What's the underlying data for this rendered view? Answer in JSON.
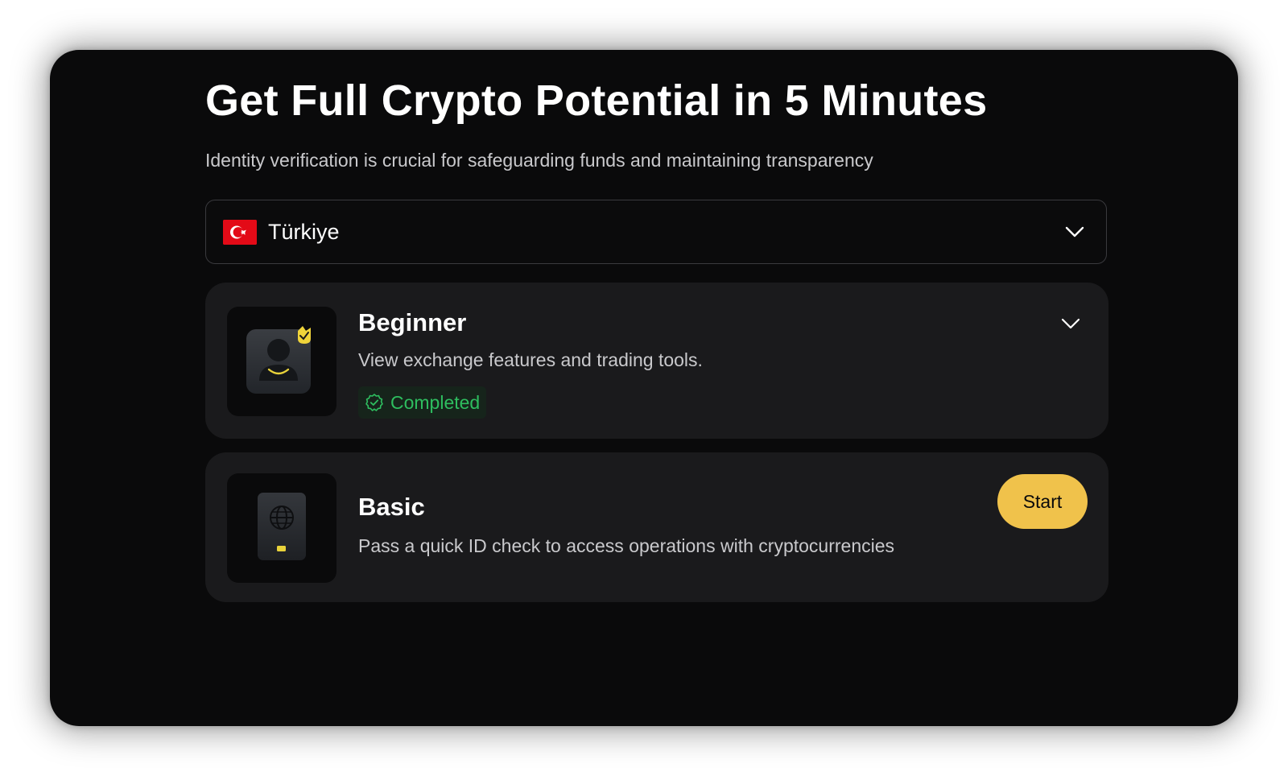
{
  "header": {
    "title": "Get Full Crypto Potential in 5 Minutes",
    "subtitle": "Identity verification is crucial for safeguarding funds and maintaining transparency"
  },
  "country_select": {
    "value": "Türkiye",
    "flag_icon": "turkey-flag-icon",
    "chevron_icon": "chevron-down-icon"
  },
  "levels": [
    {
      "title": "Beginner",
      "description": "View exchange features and trading tools.",
      "status": "Completed",
      "status_icon": "verified-check-icon",
      "thumbnail_icon": "user-profile-icon",
      "chevron_icon": "chevron-down-icon"
    },
    {
      "title": "Basic",
      "description": "Pass a quick ID check to access operations with cryptocurrencies",
      "action_label": "Start",
      "thumbnail_icon": "passport-icon"
    }
  ],
  "colors": {
    "panel_bg": "#0a0a0b",
    "card_bg": "#1a1a1c",
    "accent_yellow": "#f0c24b",
    "success_green": "#2ebd5f",
    "flag_red": "#e30a17"
  }
}
